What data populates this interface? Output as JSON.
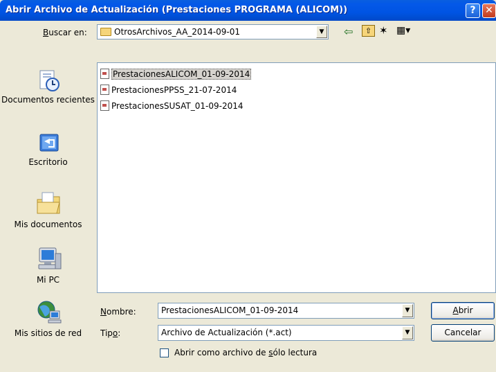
{
  "window": {
    "title": "Abrir Archivo de Actualización (Prestaciones PROGRAMA (ALICOM))",
    "help_glyph": "?",
    "close_glyph": "✕"
  },
  "lookin": {
    "label_underlined": "B",
    "label_rest": "uscar en:",
    "value": "OtrosArchivos_AA_2014-09-01"
  },
  "toolbar": {
    "back_glyph": "⇦",
    "up_glyph": "⇧",
    "newfolder_glyph": "✶",
    "views_glyph": "▦▾"
  },
  "places": [
    {
      "label": "Documentos recientes",
      "icon": "recent-documents-icon"
    },
    {
      "label": "Escritorio",
      "icon": "desktop-icon"
    },
    {
      "label": "Mis documentos",
      "icon": "my-documents-icon"
    },
    {
      "label": "Mi PC",
      "icon": "my-computer-icon"
    },
    {
      "label": "Mis sitios de red",
      "icon": "network-places-icon"
    }
  ],
  "files": [
    {
      "name": "PrestacionesALICOM_01-09-2014",
      "selected": true
    },
    {
      "name": "PrestacionesPPSS_21-07-2014",
      "selected": false
    },
    {
      "name": "PrestacionesSUSAT_01-09-2014",
      "selected": false
    }
  ],
  "filename": {
    "label_underlined": "N",
    "label_rest": "ombre:",
    "value": "PrestacionesALICOM_01-09-2014"
  },
  "filetype": {
    "label_pre": "Tip",
    "label_underlined": "o",
    "label_post": ":",
    "value": "Archivo de Actualización (*.act)"
  },
  "readonly": {
    "label_pre": "Abrir como archivo de ",
    "label_underlined": "s",
    "label_post": "ólo lectura",
    "checked": false
  },
  "buttons": {
    "open_underlined": "A",
    "open_rest": "brir",
    "cancel": "Cancelar"
  },
  "colors": {
    "titlebar": "#0054E3",
    "dialog_bg": "#ECE9D8",
    "border": "#7F9DB9"
  }
}
